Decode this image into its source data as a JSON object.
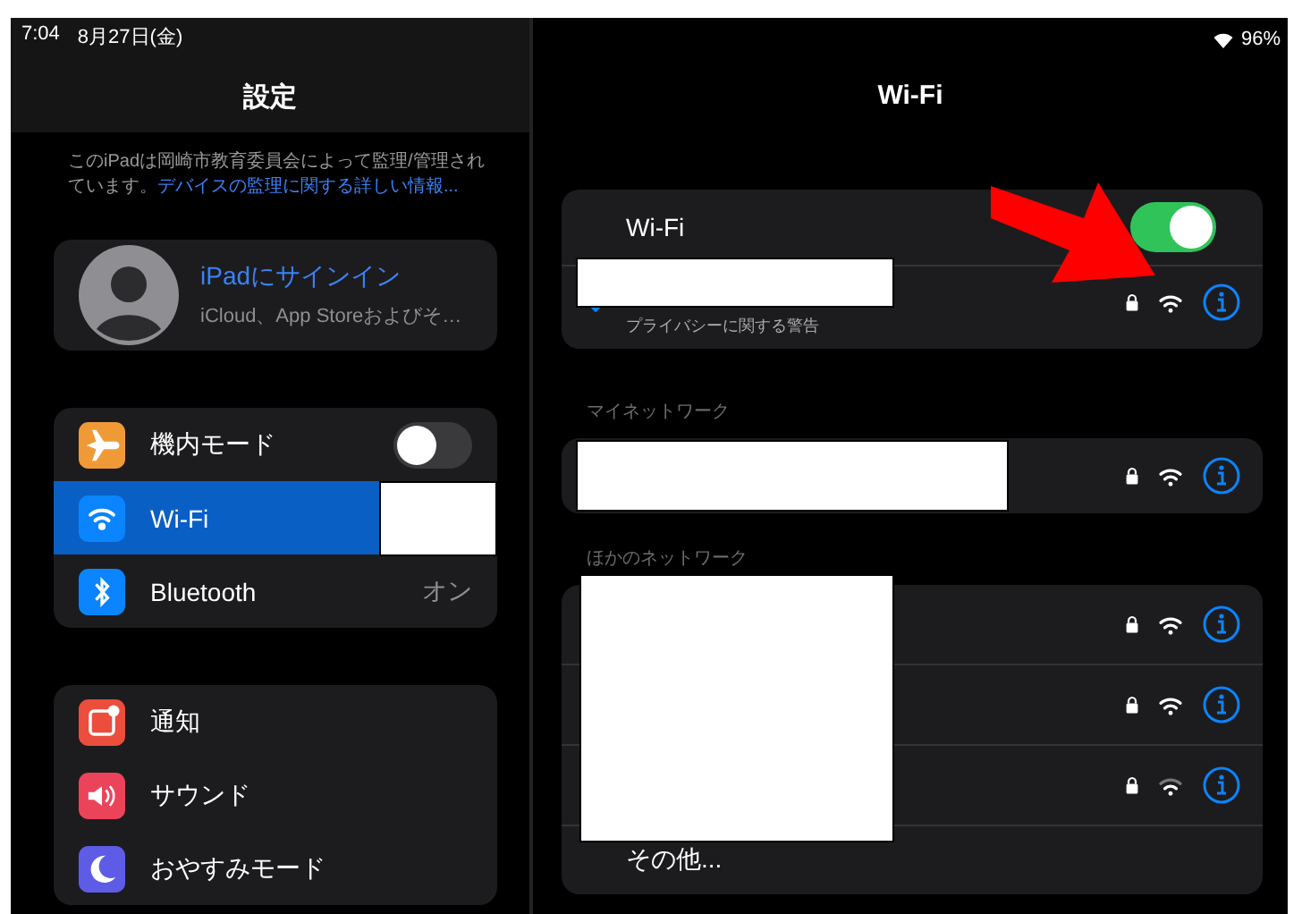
{
  "status_bar": {
    "time": "7:04",
    "date": "8月27日(金)",
    "battery": "96%"
  },
  "sidebar": {
    "title": "設定",
    "supervision_note": {
      "text": "このiPadは岡崎市教育委員会によって監理/管理されています。",
      "link": "デバイスの監理に関する詳しい情報..."
    },
    "account": {
      "title": "iPadにサインイン",
      "subtitle": "iCloud、App Storeおよびそ…"
    },
    "groups": [
      {
        "items": [
          {
            "label": "機内モード",
            "kind": "toggle",
            "on": false,
            "selected": false
          },
          {
            "label": "Wi-Fi",
            "kind": "redacted",
            "selected": true
          },
          {
            "label": "Bluetooth",
            "kind": "value",
            "value": "オン",
            "selected": false
          }
        ]
      },
      {
        "items": [
          {
            "label": "通知",
            "kind": "plain",
            "selected": false
          },
          {
            "label": "サウンド",
            "kind": "plain",
            "selected": false
          },
          {
            "label": "おやすみモード",
            "kind": "plain",
            "selected": false
          }
        ]
      }
    ]
  },
  "detail": {
    "title": "Wi-Fi",
    "wifi_toggle": {
      "label": "Wi-Fi",
      "on": true
    },
    "current_network": {
      "connected": true,
      "warning": "プライバシーに関する警告"
    },
    "my_networks": {
      "header": "マイネットワーク",
      "networks": [
        {
          "weak_signal": false
        }
      ]
    },
    "other_networks": {
      "header": "ほかのネットワーク",
      "networks": [
        {
          "weak_signal": false
        },
        {
          "weak_signal": false
        },
        {
          "weak_signal": true
        }
      ],
      "other_label": "その他..."
    }
  }
}
